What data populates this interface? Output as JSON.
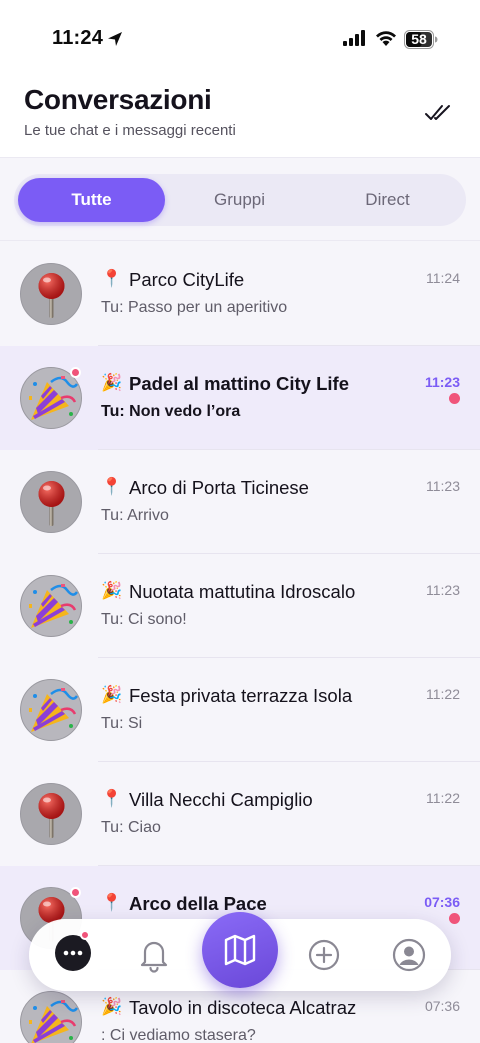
{
  "status_bar": {
    "time": "11:24",
    "battery": "58"
  },
  "header": {
    "title": "Conversazioni",
    "subtitle": "Le tue chat e i messaggi recenti"
  },
  "filters": [
    "Tutte",
    "Gruppi",
    "Direct"
  ],
  "active_filter": "Tutte",
  "conversations": [
    {
      "icon": "pin",
      "emoji": "📍",
      "title": "Parco CityLife",
      "preview": "Tu: Passo per un aperitivo",
      "time": "11:24",
      "unread": false
    },
    {
      "icon": "party",
      "emoji": "🎉",
      "title": "Padel al mattino City Life",
      "preview": "Tu: Non vedo l’ora",
      "time": "11:23",
      "unread": true
    },
    {
      "icon": "pin",
      "emoji": "📍",
      "title": "Arco di Porta Ticinese",
      "preview": "Tu: Arrivo",
      "time": "11:23",
      "unread": false
    },
    {
      "icon": "party",
      "emoji": "🎉",
      "title": "Nuotata mattutina Idroscalo",
      "preview": "Tu: Ci sono!",
      "time": "11:23",
      "unread": false
    },
    {
      "icon": "party",
      "emoji": "🎉",
      "title": "Festa privata terrazza Isola",
      "preview": "Tu: Si",
      "time": "11:22",
      "unread": false
    },
    {
      "icon": "pin",
      "emoji": "📍",
      "title": "Villa Necchi Campiglio",
      "preview": "Tu: Ciao",
      "time": "11:22",
      "unread": false
    },
    {
      "icon": "pin",
      "emoji": "📍",
      "title": "Arco della Pace",
      "preview": "",
      "time": "07:36",
      "unread": true
    },
    {
      "icon": "party",
      "emoji": "🎉",
      "title": "Tavolo in discoteca Alcatraz",
      "preview": ": Ci vediamo stasera?",
      "time": "07:36",
      "unread": false
    }
  ],
  "tab_bar": {
    "items": [
      "chat-icon",
      "bell-icon",
      "map-icon",
      "plus-circle-icon",
      "profile-icon"
    ],
    "active": "chat-icon"
  },
  "colors": {
    "accent": "#7b5cf5",
    "unread_dot": "#f0547a",
    "unread_row_bg": "#efebfa"
  }
}
